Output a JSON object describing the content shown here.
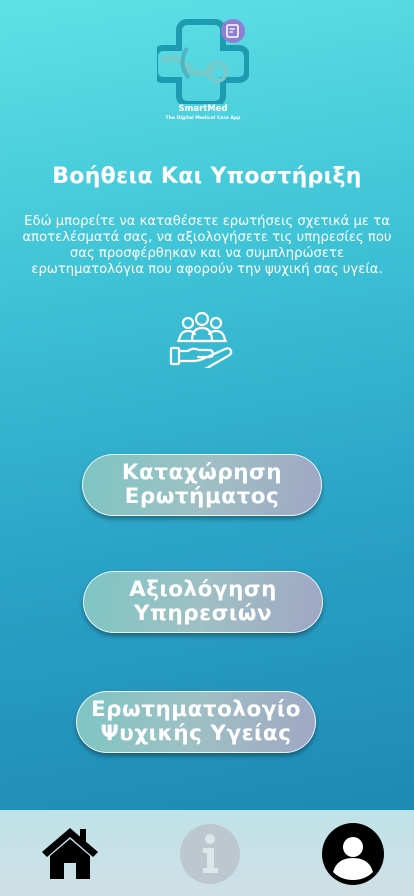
{
  "logo": {
    "name": "SmartMed",
    "tagline": "The Digital Medical Care App",
    "colors": {
      "primary": "#1e9bb0",
      "secondary": "#78c9c9",
      "badge": "#8f7fd4"
    }
  },
  "page": {
    "title": "Βοήθεια Και Υποστήριξη",
    "description": "Εδώ μπορείτε να καταθέσετε ερωτήσεις σχετικά με τα αποτελέσματά σας, να αξιολογήσετε τις υπηρεσίες που σας προσφέρθηκαν και να συμπληρώσετε ερωτηματολόγια που αφορούν την ψυχική σας υγεία.",
    "illustration_icon": "helping-hand-people-icon"
  },
  "buttons": [
    {
      "line1": "Καταχώρηση",
      "line2": "Ερωτήματος"
    },
    {
      "line1": "Αξιολόγηση",
      "line2": "Υπηρεσιών"
    },
    {
      "line1": "Ερωτηματολογίο",
      "line2": "Ψυχικής Υγείας"
    }
  ],
  "bottom_nav": {
    "items": [
      {
        "icon": "home-icon",
        "state": "active"
      },
      {
        "icon": "info-icon",
        "state": "disabled"
      },
      {
        "icon": "profile-icon",
        "state": "active"
      }
    ]
  },
  "colors": {
    "gradient_top": "#5fe1e6",
    "gradient_bottom": "#1a82b0",
    "button_fill": "#9fc0c4",
    "nav_background": "#cfe0e6",
    "text": "#ffffff"
  }
}
